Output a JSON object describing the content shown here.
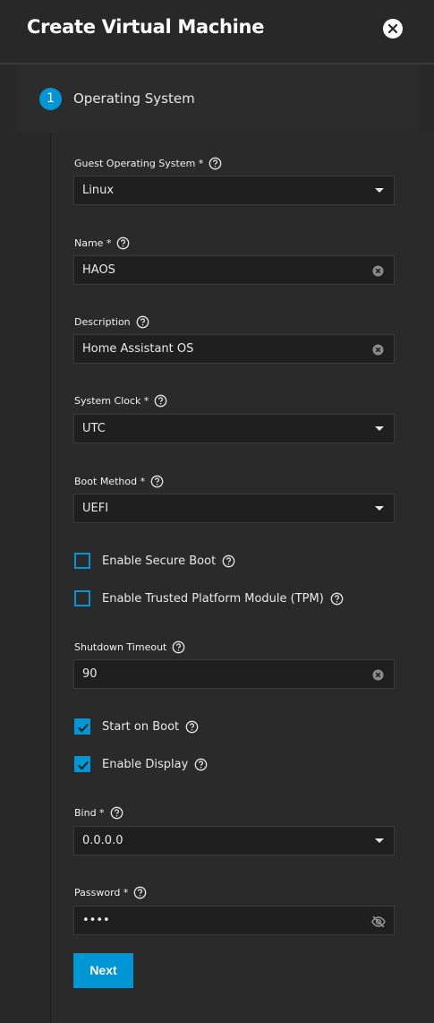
{
  "dialog": {
    "title": "Create Virtual Machine",
    "close_icon": "close-icon"
  },
  "step": {
    "number": "1",
    "label": "Operating System"
  },
  "fields": {
    "guest_os": {
      "label": "Guest Operating System *",
      "value": "Linux"
    },
    "name": {
      "label": "Name *",
      "value": "HAOS"
    },
    "description": {
      "label": "Description",
      "value": "Home Assistant OS"
    },
    "system_clock": {
      "label": "System Clock *",
      "value": "UTC"
    },
    "boot_method": {
      "label": "Boot Method *",
      "value": "UEFI"
    },
    "shutdown_timeout": {
      "label": "Shutdown Timeout",
      "value": "90"
    },
    "bind": {
      "label": "Bind *",
      "value": "0.0.0.0"
    },
    "password": {
      "label": "Password *",
      "value": "••••"
    }
  },
  "checkboxes": {
    "secure_boot": {
      "label": "Enable Secure Boot",
      "checked": false
    },
    "tpm": {
      "label": "Enable Trusted Platform Module (TPM)",
      "checked": false
    },
    "start_on_boot": {
      "label": "Start on Boot",
      "checked": true
    },
    "enable_display": {
      "label": "Enable Display",
      "checked": true
    }
  },
  "actions": {
    "next_label": "Next"
  },
  "colors": {
    "accent": "#0095d5",
    "background": "#282828",
    "input_bg": "#1f1f1f"
  }
}
